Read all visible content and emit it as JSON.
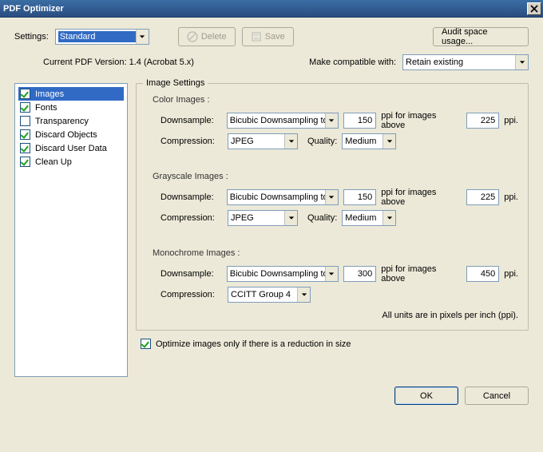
{
  "window": {
    "title": "PDF Optimizer",
    "close_label": "×"
  },
  "toolbar": {
    "settings_label": "Settings:",
    "settings_value": "Standard",
    "delete_label": "Delete",
    "save_label": "Save",
    "audit_label": "Audit space usage..."
  },
  "versionrow": {
    "current_label": "Current PDF Version: 1.4 (Acrobat 5.x)",
    "compat_label": "Make compatible with:",
    "compat_value": "Retain existing"
  },
  "categories": {
    "items": [
      {
        "label": "Images",
        "checked": true,
        "selected": true
      },
      {
        "label": "Fonts",
        "checked": true,
        "selected": false
      },
      {
        "label": "Transparency",
        "checked": false,
        "selected": false
      },
      {
        "label": "Discard Objects",
        "checked": true,
        "selected": false
      },
      {
        "label": "Discard User Data",
        "checked": true,
        "selected": false
      },
      {
        "label": "Clean Up",
        "checked": true,
        "selected": false
      }
    ]
  },
  "image_settings": {
    "legend": "Image Settings",
    "color_head": "Color Images :",
    "gray_head": "Grayscale Images :",
    "mono_head": "Monochrome Images :",
    "downsample_label": "Downsample:",
    "compression_label": "Compression:",
    "quality_label": "Quality:",
    "above_label": "ppi for images above",
    "ppi_label": "ppi.",
    "color": {
      "downsample_method": "Bicubic Downsampling to",
      "ppi": "150",
      "above_ppi": "225",
      "compression": "JPEG",
      "quality": "Medium"
    },
    "gray": {
      "downsample_method": "Bicubic Downsampling to",
      "ppi": "150",
      "above_ppi": "225",
      "compression": "JPEG",
      "quality": "Medium"
    },
    "mono": {
      "downsample_method": "Bicubic Downsampling to",
      "ppi": "300",
      "above_ppi": "450",
      "compression": "CCITT Group 4"
    },
    "units_note": "All units are in pixels per inch (ppi)."
  },
  "optimize_checkbox": {
    "checked": true,
    "label": "Optimize images only if there is a reduction in size"
  },
  "footer": {
    "ok": "OK",
    "cancel": "Cancel"
  }
}
